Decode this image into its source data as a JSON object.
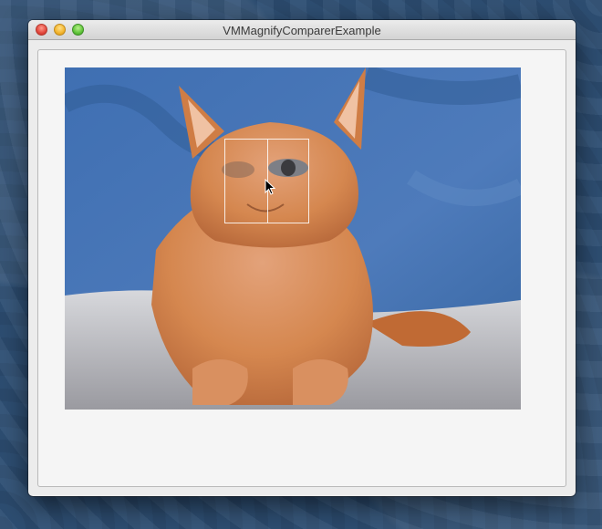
{
  "window": {
    "title": "VMMagnifyComparerExample"
  },
  "photo": {
    "subject": "kitten"
  },
  "colors": {
    "background_fabric": "#4c78b6",
    "blanket": "#c9c9cd",
    "fur": "#d9884f"
  }
}
